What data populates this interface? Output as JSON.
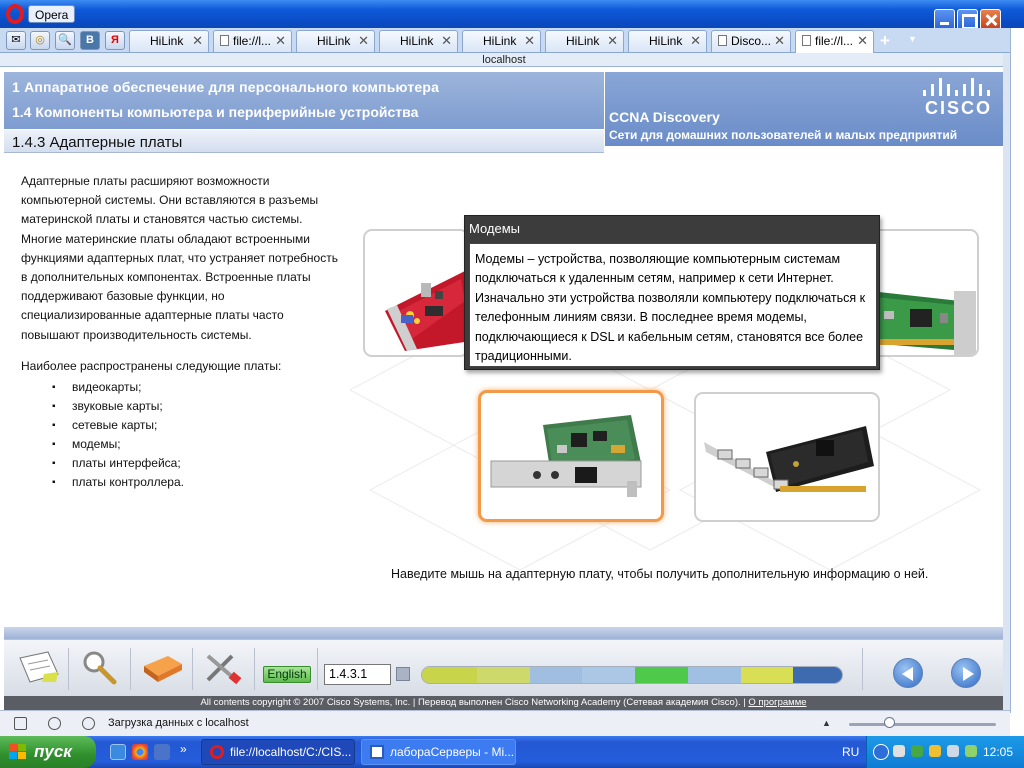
{
  "window": {
    "app_title": "Opera",
    "address": "localhost"
  },
  "tabs": [
    {
      "label": "HiLink"
    },
    {
      "label": "file://l..."
    },
    {
      "label": "HiLink"
    },
    {
      "label": "HiLink"
    },
    {
      "label": "HiLink"
    },
    {
      "label": "HiLink"
    },
    {
      "label": "HiLink"
    },
    {
      "label": "Disco..."
    },
    {
      "label": "file://l..."
    }
  ],
  "quick_buttons": {
    "mail": "✉",
    "opera": "◎",
    "search": "🔍",
    "vk": "В",
    "yandex": "Я"
  },
  "header": {
    "chapter": "1 Аппаратное обеспечение для персонального компьютера",
    "section": "1.4 Компоненты компьютера и периферийные устройства",
    "course": "CCNA Discovery",
    "course_subtitle": "Сети для домашних пользователей и малых предприятий",
    "logo_text": "CISCO",
    "page_title": "1.4.3 Адаптерные платы"
  },
  "content": {
    "intro": "Адаптерные платы расширяют возможности компьютерной системы. Они вставляются в разъемы материнской платы и становятся частью системы. Многие материнские платы обладают встроенными функциями адаптерных плат, что устраняет потребность в дополнительных компонентах. Встроенные платы поддерживают базовые функции, но специализированные адаптерные платы часто повышают производительность системы.",
    "common_title": "Наиболее распространены следующие платы:",
    "cards": [
      "видеокарты;",
      "звуковые карты;",
      "сетевые карты;",
      "модемы;",
      "платы интерфейса;",
      "платы контроллера."
    ],
    "popup": {
      "title": "Модемы",
      "text": "Модемы – устройства, позволяющие компьютерным системам подключаться к удаленным сетям, например к сети Интернет. Изначально эти устройства позволяли компьютеру подключаться к телефонным линиям связи.  В последнее время модемы, подключающиеся к DSL и кабельным сетям, становятся все более традиционными."
    },
    "hint": "Наведите мышь на адаптерную плату, чтобы получить дополнительную информацию о ней."
  },
  "navbar": {
    "language": "English",
    "page_number": "1.4.3.1",
    "progress_colors": [
      "#c8d44a",
      "#cdd96b",
      "#9fbee0",
      "#aac8e6",
      "#8fb7e0",
      "#4ec94a",
      "#9fc0e2",
      "#8cb2dc",
      "#d9df55",
      "#3e6bb0"
    ]
  },
  "copyright": {
    "text": "All contents copyright © 2007 Cisco Systems, Inc. | Перевод выполнен Cisco Networking Academy (Сетевая академия Cisco). |",
    "about": "О программе"
  },
  "statusbar": {
    "text": "Загрузка данных с localhost"
  },
  "taskbar": {
    "start": "пуск",
    "items": [
      {
        "label": "file://localhost/C:/CIS..."
      },
      {
        "label": "лабораСерверы - Mi..."
      }
    ],
    "lang": "RU",
    "clock": "12:05",
    "more": "»"
  },
  "colors": {
    "accent": "#7e9cd0",
    "highlight": "#f39a4a",
    "title_bar": "#0a4cc6"
  }
}
